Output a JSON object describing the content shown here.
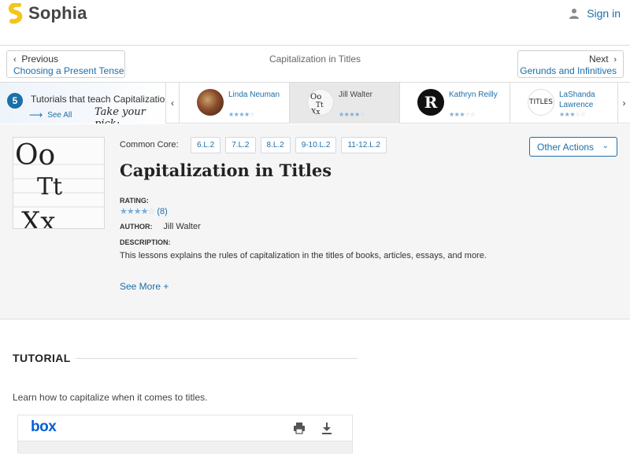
{
  "brand": {
    "name": "Sophia",
    "accent": "#1c6fa8",
    "logo_color": "#f5c518"
  },
  "header": {
    "signin_label": "Sign in"
  },
  "nav": {
    "prev_label": "Previous",
    "prev_title": "Choosing a Present Tense",
    "center_title": "Capitalization in Titles",
    "next_label": "Next",
    "next_title": "Gerunds and Infinitives"
  },
  "carousel": {
    "count": "5",
    "intro_text": "Tutorials that teach Capitalizatio",
    "see_all": "See All",
    "pick_text": "Take your pick:",
    "cards": [
      {
        "name": "Linda Neuman",
        "rating": 4,
        "selected": false
      },
      {
        "name": "Jill Walter",
        "rating": 3.5,
        "selected": true
      },
      {
        "name": "Kathryn Reilly",
        "rating": 3,
        "selected": false
      },
      {
        "name": "LaShanda Lawrence",
        "rating": 2.5,
        "selected": false
      }
    ],
    "card3_thumb_letter": "R",
    "card4_thumb_text": "TITLES"
  },
  "detail": {
    "common_core_label": "Common Core:",
    "standards": [
      "6.L.2",
      "7.L.2",
      "8.L.2",
      "9-10.L.2",
      "11-12.L.2"
    ],
    "other_actions": "Other Actions",
    "title": "Capitalization in Titles",
    "rating_label": "RATING:",
    "rating_value": 3.5,
    "rating_count": "(8)",
    "author_label": "AUTHOR:",
    "author": "Jill Walter",
    "description_label": "DESCRIPTION:",
    "description": "This lessons explains the rules of capitalization in the titles of books, articles, essays, and more.",
    "see_more": "See More +"
  },
  "tutorial": {
    "heading": "TUTORIAL",
    "description": "Learn how to capitalize when it comes to titles.",
    "viewer_brand": "box"
  }
}
